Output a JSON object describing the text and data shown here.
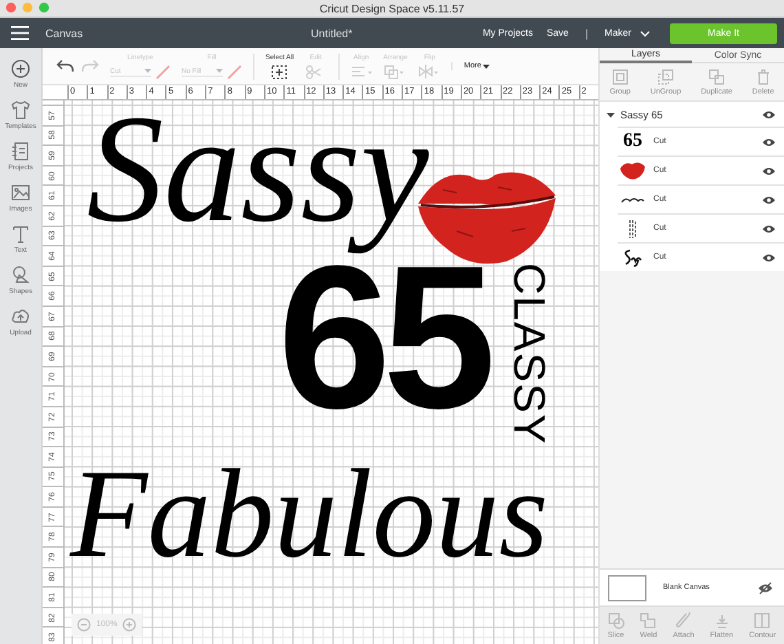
{
  "window": {
    "title": "Cricut Design Space  v5.11.57"
  },
  "header": {
    "section": "Canvas",
    "document": "Untitled*",
    "links": [
      "My Projects",
      "Save"
    ],
    "separator": "|",
    "machine": "Maker",
    "make_button": "Make It"
  },
  "sidebar": {
    "items": [
      {
        "kind": "new",
        "label": "New"
      },
      {
        "kind": "templates",
        "label": "Templates"
      },
      {
        "kind": "projects",
        "label": "Projects"
      },
      {
        "kind": "images",
        "label": "Images"
      },
      {
        "kind": "text",
        "label": "Text"
      },
      {
        "kind": "shapes",
        "label": "Shapes"
      },
      {
        "kind": "upload",
        "label": "Upload"
      }
    ]
  },
  "history": [
    {
      "kind": "undo",
      "disabled": false
    },
    {
      "kind": "redo",
      "disabled": true
    }
  ],
  "toolbar": [
    {
      "kind": "dropdown",
      "label": "Linetype",
      "value": "Cut",
      "disabled": true
    },
    {
      "kind": "dropdown",
      "label": "Fill",
      "value": "No Fill",
      "disabled": true
    },
    {
      "kind": "select",
      "label": "Select All",
      "disabled": false
    },
    {
      "kind": "edit",
      "label": "Edit",
      "disabled": true
    },
    {
      "kind": "align",
      "label": "Align",
      "disabled": true
    },
    {
      "kind": "arrange",
      "label": "Arrange",
      "disabled": true
    },
    {
      "kind": "flip",
      "label": "Flip",
      "disabled": true
    },
    {
      "kind": "more",
      "label": "More",
      "disabled": false
    }
  ],
  "rulers": {
    "horizontal": [
      "0",
      "1",
      "2",
      "3",
      "4",
      "5",
      "6",
      "7",
      "8",
      "9",
      "10",
      "11",
      "12",
      "13",
      "14",
      "15",
      "16",
      "17",
      "18",
      "19",
      "20",
      "21",
      "22",
      "23",
      "24",
      "25",
      "2"
    ],
    "vertical": [
      "57",
      "58",
      "59",
      "60",
      "61",
      "62",
      "63",
      "64",
      "65",
      "66",
      "67",
      "68",
      "69",
      "70",
      "71",
      "72",
      "73",
      "74",
      "75",
      "76",
      "77",
      "78",
      "79",
      "80",
      "81",
      "82",
      "83"
    ]
  },
  "artwork": {
    "top_word": "Sassy",
    "number": "65",
    "side_word": "CLASSY",
    "bottom_word": "Fabulous"
  },
  "zoom": {
    "value": "100%"
  },
  "panel": {
    "tabs": [
      {
        "label": "Layers",
        "selected": true
      },
      {
        "label": "Color Sync",
        "selected": false
      }
    ],
    "actions": [
      {
        "kind": "group",
        "label": "Group",
        "disabled": true
      },
      {
        "kind": "ungroup",
        "label": "UnGroup",
        "disabled": true
      },
      {
        "kind": "duplicate",
        "label": "Duplicate",
        "disabled": true
      },
      {
        "kind": "delete",
        "label": "Delete",
        "disabled": true
      }
    ],
    "group": {
      "name": "Sassy 65",
      "expanded": true,
      "children": [
        {
          "kind": "digits",
          "thumb": "65",
          "operation": "Cut",
          "visible": true
        },
        {
          "kind": "lips",
          "operation": "Cut",
          "visible": true
        },
        {
          "kind": "script",
          "operation": "Cut",
          "visible": true
        },
        {
          "kind": "vertical",
          "operation": "Cut",
          "visible": true
        },
        {
          "kind": "monogram",
          "operation": "Cut",
          "visible": true
        }
      ]
    },
    "blank_canvas": {
      "label": "Blank Canvas",
      "visible": false
    },
    "bottom_actions": [
      {
        "kind": "slice",
        "label": "Slice",
        "disabled": true
      },
      {
        "kind": "weld",
        "label": "Weld",
        "disabled": true
      },
      {
        "kind": "attach",
        "label": "Attach",
        "disabled": true
      },
      {
        "kind": "flatten",
        "label": "Flatten",
        "disabled": true
      },
      {
        "kind": "contour",
        "label": "Contour",
        "disabled": true
      }
    ]
  }
}
